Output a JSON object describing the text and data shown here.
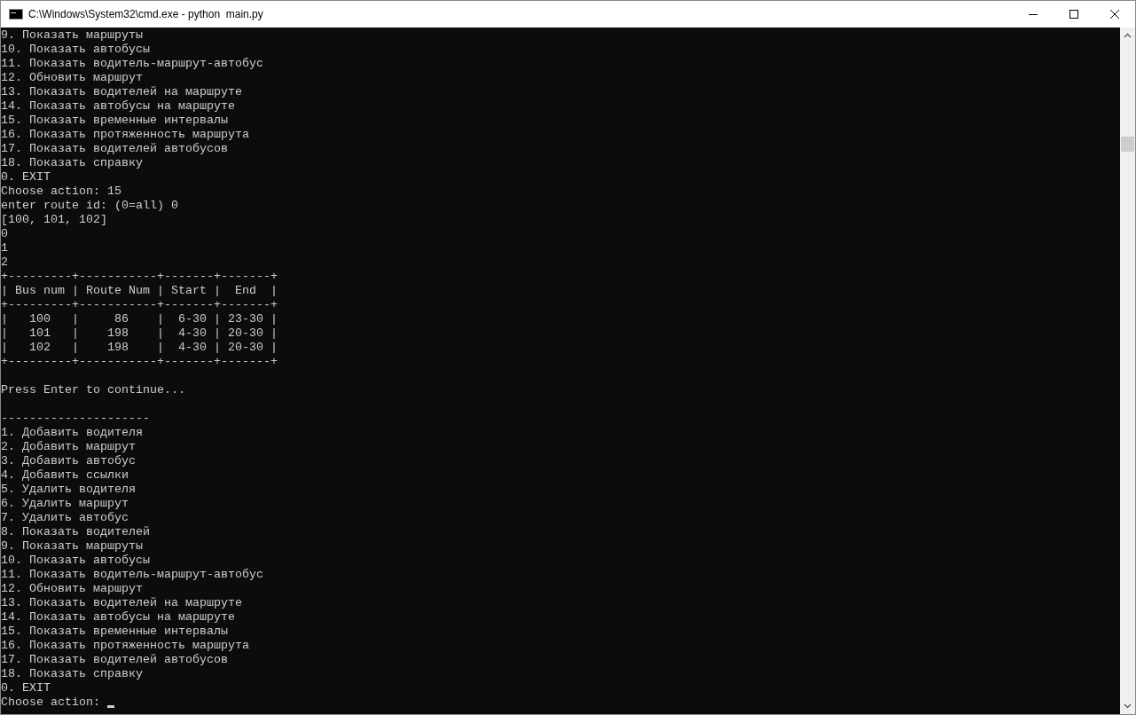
{
  "window": {
    "title": "C:\\Windows\\System32\\cmd.exe - python  main.py"
  },
  "console": {
    "lines": [
      {
        "kind": "text",
        "text": "9. Показать маршруты"
      },
      {
        "kind": "text",
        "text": "10. Показать автобусы"
      },
      {
        "kind": "text",
        "text": "11. Показать водитель-маршрут-автобус"
      },
      {
        "kind": "text",
        "text": "12. Обновить маршрут"
      },
      {
        "kind": "text",
        "text": "13. Показать водителей на маршруте"
      },
      {
        "kind": "text",
        "text": "14. Показать автобусы на маршруте"
      },
      {
        "kind": "text",
        "text": "15. Показать временные интервалы"
      },
      {
        "kind": "text",
        "text": "16. Показать протяженность маршрута"
      },
      {
        "kind": "text",
        "text": "17. Показать водителей автобусов"
      },
      {
        "kind": "text",
        "text": "18. Показать справку"
      },
      {
        "kind": "text",
        "text": "0. EXIT"
      },
      {
        "kind": "text",
        "text": "Choose action: 15"
      },
      {
        "kind": "text",
        "text": "enter route id: (0=all) 0"
      },
      {
        "kind": "text",
        "text": "[100, 101, 102]"
      },
      {
        "kind": "text",
        "text": "0"
      },
      {
        "kind": "text",
        "text": "1"
      },
      {
        "kind": "text",
        "text": "2"
      },
      {
        "kind": "text",
        "text": "+---------+-----------+-------+-------+"
      },
      {
        "kind": "text",
        "text": "| Bus num | Route Num | Start |  End  |"
      },
      {
        "kind": "text",
        "text": "+---------+-----------+-------+-------+"
      },
      {
        "kind": "text",
        "text": "|   100   |     86    |  6-30 | 23-30 |"
      },
      {
        "kind": "text",
        "text": "|   101   |    198    |  4-30 | 20-30 |"
      },
      {
        "kind": "text",
        "text": "|   102   |    198    |  4-30 | 20-30 |"
      },
      {
        "kind": "text",
        "text": "+---------+-----------+-------+-------+"
      },
      {
        "kind": "blank"
      },
      {
        "kind": "text",
        "text": "Press Enter to continue..."
      },
      {
        "kind": "blank"
      },
      {
        "kind": "text",
        "text": "---------------------"
      },
      {
        "kind": "text",
        "text": "1. Добавить водителя"
      },
      {
        "kind": "text",
        "text": "2. Добавить маршрут"
      },
      {
        "kind": "text",
        "text": "3. Добавить автобус"
      },
      {
        "kind": "text",
        "text": "4. Добавить ссылки"
      },
      {
        "kind": "text",
        "text": "5. Удалить водителя"
      },
      {
        "kind": "text",
        "text": "6. Удалить маршрут"
      },
      {
        "kind": "text",
        "text": "7. Удалить автобус"
      },
      {
        "kind": "text",
        "text": "8. Показать водителей"
      },
      {
        "kind": "text",
        "text": "9. Показать маршруты"
      },
      {
        "kind": "text",
        "text": "10. Показать автобусы"
      },
      {
        "kind": "text",
        "text": "11. Показать водитель-маршрут-автобус"
      },
      {
        "kind": "text",
        "text": "12. Обновить маршрут"
      },
      {
        "kind": "text",
        "text": "13. Показать водителей на маршруте"
      },
      {
        "kind": "text",
        "text": "14. Показать автобусы на маршруте"
      },
      {
        "kind": "text",
        "text": "15. Показать временные интервалы"
      },
      {
        "kind": "text",
        "text": "16. Показать протяженность маршрута"
      },
      {
        "kind": "text",
        "text": "17. Показать водителей автобусов"
      },
      {
        "kind": "text",
        "text": "18. Показать справку"
      },
      {
        "kind": "text",
        "text": "0. EXIT"
      },
      {
        "kind": "prompt",
        "text": "Choose action: "
      }
    ]
  }
}
